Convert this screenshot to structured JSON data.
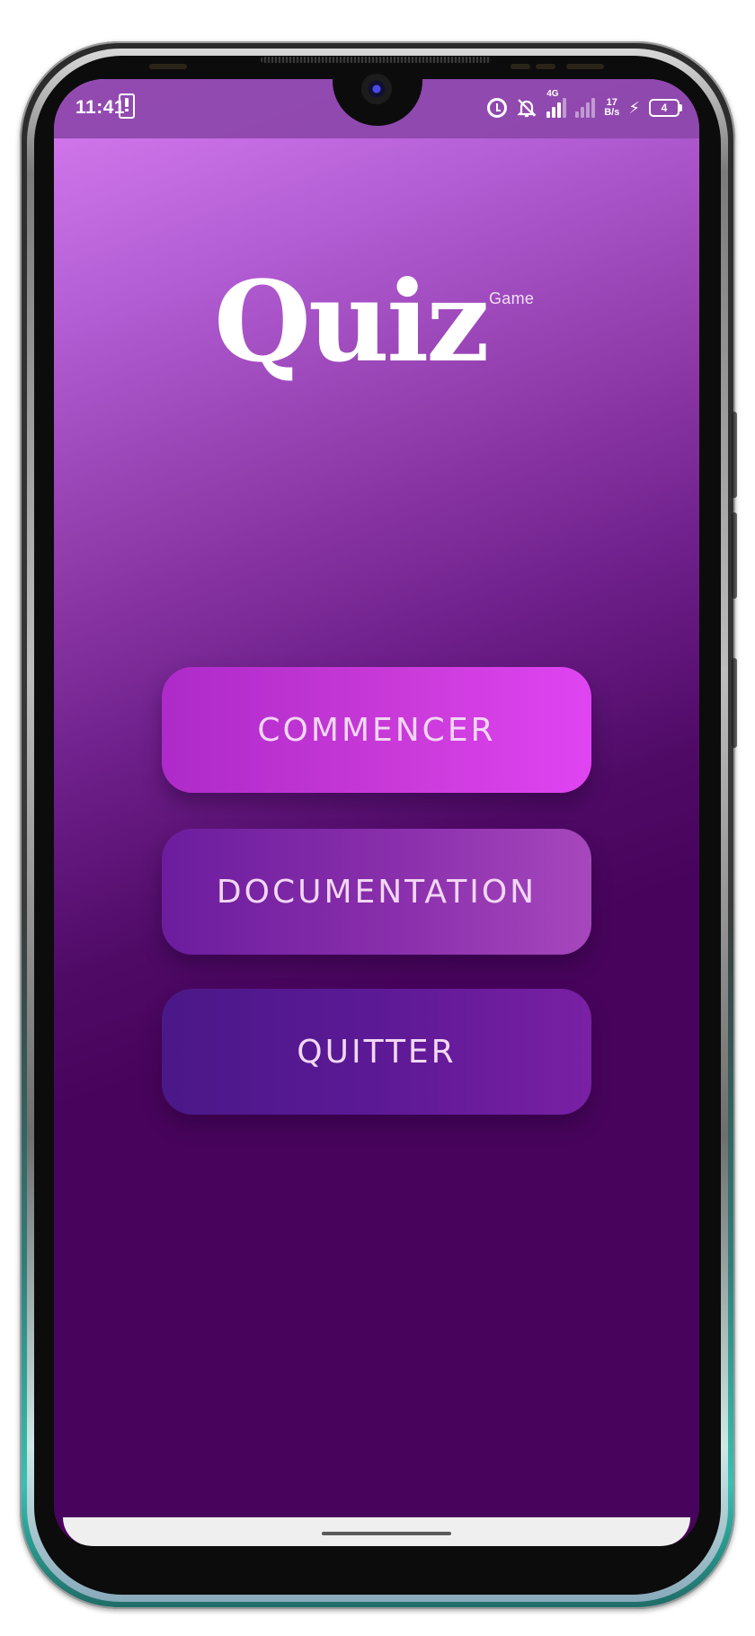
{
  "status_bar": {
    "time": "11:41",
    "network_type": "4G",
    "data_speed_value": "17",
    "data_speed_unit": "B/s",
    "battery_level": "4",
    "icons": [
      "alert-phone-icon",
      "alarm-icon",
      "bell-off-icon",
      "signal-icon",
      "signal-weak-icon",
      "charging-icon",
      "battery-icon"
    ]
  },
  "logo": {
    "title": "Quiz",
    "subtitle": "Game"
  },
  "menu": {
    "start_label": "COMMENCER",
    "docs_label": "DOCUMENTATION",
    "quit_label": "QUITTER"
  },
  "colors": {
    "background_top": "#d97cf0",
    "background_bottom": "#48045c",
    "button_start": "#c93ad9",
    "button_docs": "#8a2fac",
    "button_quit": "#5c1996",
    "button_text": "#f2d7f3"
  }
}
